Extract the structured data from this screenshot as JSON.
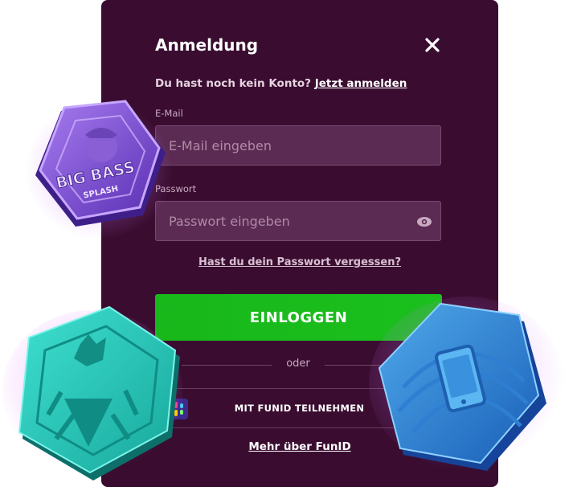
{
  "modal": {
    "title": "Anmeldung",
    "close_icon": "close-icon",
    "signup_prompt": "Du hast noch kein Konto?",
    "signup_link": "Jetzt anmelden",
    "email": {
      "label": "E-Mail",
      "placeholder": "E-Mail eingeben",
      "value": ""
    },
    "password": {
      "label": "Passwort",
      "placeholder": "Passwort eingeben",
      "value": "",
      "toggle_icon": "eye-icon"
    },
    "forgot_link": "Hast du dein Passwort vergessen?",
    "login_button": "EINLOGGEN",
    "divider": "oder",
    "funid_button": "MIT FUNID TEILNEHMEN",
    "funid_icon": "funid-logo-icon",
    "more_link": "Mehr über FunID"
  },
  "decorations": {
    "badge_purple": {
      "icon": "big-bass-splash-badge",
      "line1": "BIG BASS",
      "line2": "SPLASH"
    },
    "badge_teal": {
      "icon": "teal-hexagon-badge"
    },
    "badge_blue": {
      "icon": "phone-hexagon-badge"
    }
  },
  "colors": {
    "modal_bg": "#3a0d30",
    "input_bg": "#5b2b54",
    "login_green": "#1bba1d",
    "text_white": "#ffffff"
  }
}
